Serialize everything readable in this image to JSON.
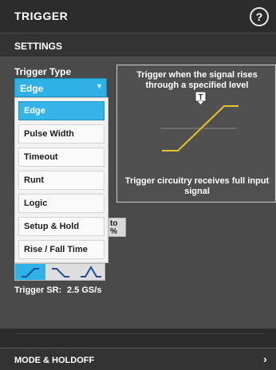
{
  "window": {
    "title": "TRIGGER",
    "help_icon": "help-circle-icon",
    "help_glyph": "?"
  },
  "settings": {
    "header": "SETTINGS"
  },
  "trigger_type": {
    "label": "Trigger Type",
    "selected": "Edge",
    "options": [
      "Edge",
      "Pulse Width",
      "Timeout",
      "Runt",
      "Logic",
      "Setup & Hold",
      "Rise / Fall Time"
    ]
  },
  "partial_button": {
    "text": "to %"
  },
  "slope": {
    "options_icons": [
      "rising-edge-icon",
      "falling-edge-icon",
      "either-edge-icon"
    ],
    "selected_index": 0
  },
  "sample_rate": {
    "label": "Trigger SR:",
    "value": "2.5 GS/s"
  },
  "preview": {
    "caption_top": "Trigger when the signal rises through a specified level",
    "caption_bottom": "Trigger circuitry receives full input signal",
    "marker_icon": "trigger-marker-icon",
    "marker_letter": "T",
    "signal_color": "#e6c228",
    "level_color": "#8a8a8a"
  },
  "footer": {
    "mode_holdoff": "MODE & HOLDOFF",
    "chevron": "›"
  },
  "colors": {
    "accent": "#2fb1e6",
    "panel": "#4a4a4a",
    "header": "#2c2c2c"
  }
}
